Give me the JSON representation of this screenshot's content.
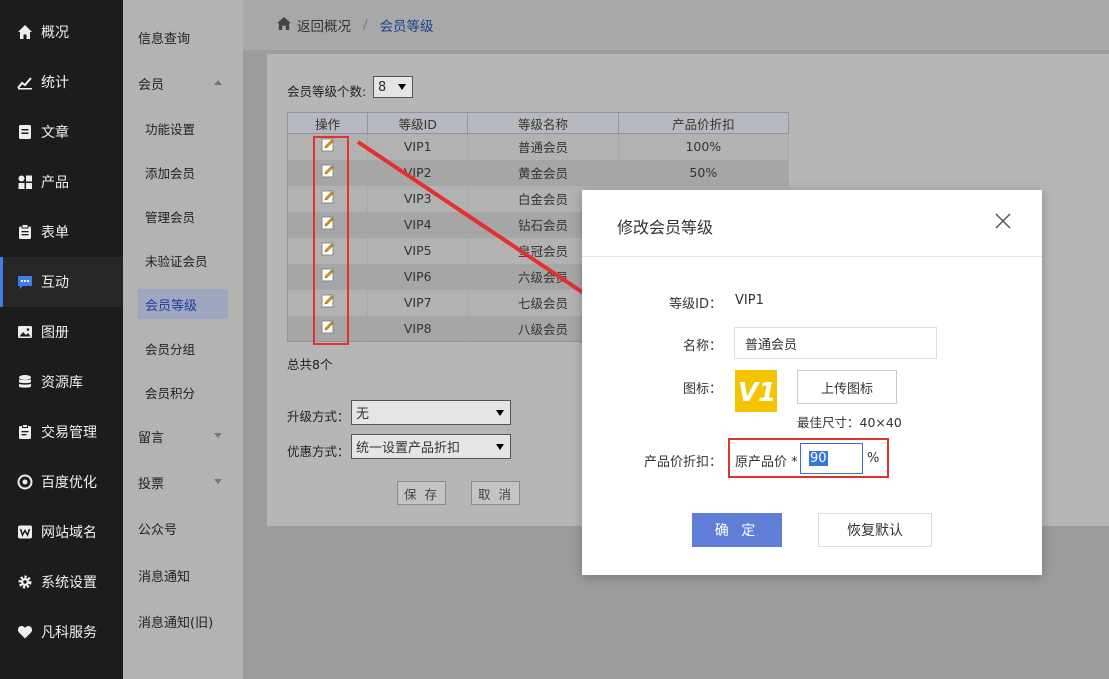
{
  "sidebar": {
    "items": [
      {
        "label": "概况",
        "icon": "home-icon"
      },
      {
        "label": "统计",
        "icon": "chart-icon"
      },
      {
        "label": "文章",
        "icon": "article-icon"
      },
      {
        "label": "产品",
        "icon": "grid-icon"
      },
      {
        "label": "表单",
        "icon": "form-icon"
      },
      {
        "label": "互动",
        "icon": "chat-icon"
      },
      {
        "label": "图册",
        "icon": "image-icon"
      },
      {
        "label": "资源库",
        "icon": "database-icon"
      },
      {
        "label": "交易管理",
        "icon": "clipboard-icon"
      },
      {
        "label": "百度优化",
        "icon": "target-icon"
      },
      {
        "label": "网站域名",
        "icon": "w-icon"
      },
      {
        "label": "系统设置",
        "icon": "gear-icon"
      },
      {
        "label": "凡科服务",
        "icon": "heart-icon"
      }
    ],
    "active": "互动"
  },
  "submenu": {
    "items": [
      "信息查询",
      "会员",
      "功能设置",
      "添加会员",
      "管理会员",
      "未验证会员",
      "会员等级",
      "会员分组",
      "会员积分",
      "留言",
      "投票",
      "公众号",
      "消息通知",
      "消息通知(旧)"
    ],
    "active": "会员等级"
  },
  "breadcrumb": {
    "back": "返回概况",
    "separator": "/",
    "current": "会员等级"
  },
  "level_count": {
    "label": "会员等级个数:",
    "value": "8"
  },
  "table": {
    "headers": [
      "操作",
      "等级ID",
      "等级名称",
      "产品价折扣"
    ],
    "rows": [
      {
        "id": "VIP1",
        "name": "普通会员",
        "discount": "100%"
      },
      {
        "id": "VIP2",
        "name": "黄金会员",
        "discount": "50%"
      },
      {
        "id": "VIP3",
        "name": "白金会员",
        "discount": ""
      },
      {
        "id": "VIP4",
        "name": "钻石会员",
        "discount": ""
      },
      {
        "id": "VIP5",
        "name": "皇冠会员",
        "discount": ""
      },
      {
        "id": "VIP6",
        "name": "六级会员",
        "discount": ""
      },
      {
        "id": "VIP7",
        "name": "七级会员",
        "discount": ""
      },
      {
        "id": "VIP8",
        "name": "八级会员",
        "discount": ""
      }
    ]
  },
  "total": "总共8个",
  "upgrade": {
    "label": "升级方式：",
    "value": "无"
  },
  "discount_mode": {
    "label": "优惠方式：",
    "value": "统一设置产品折扣"
  },
  "buttons": {
    "save": "保 存",
    "cancel": "取 消"
  },
  "dialog": {
    "title": "修改会员等级",
    "level_id_label": "等级ID：",
    "level_id_value": "VIP1",
    "name_label": "名称：",
    "name_value": "普通会员",
    "icon_label": "图标：",
    "logo_text": "V1",
    "upload_label": "上传图标",
    "best_size": "最佳尺寸：40×40",
    "discount_label": "产品价折扣：",
    "orig_price_label": "原产品价 *",
    "discount_value": "90",
    "percent": "%",
    "ok": "确 定",
    "reset": "恢复默认"
  },
  "colors": {
    "accent": "#5f7ed8",
    "highlight_red": "#e3312d",
    "sidebar_bg": "#1c1c1c",
    "logo_yellow": "#f5c400"
  }
}
